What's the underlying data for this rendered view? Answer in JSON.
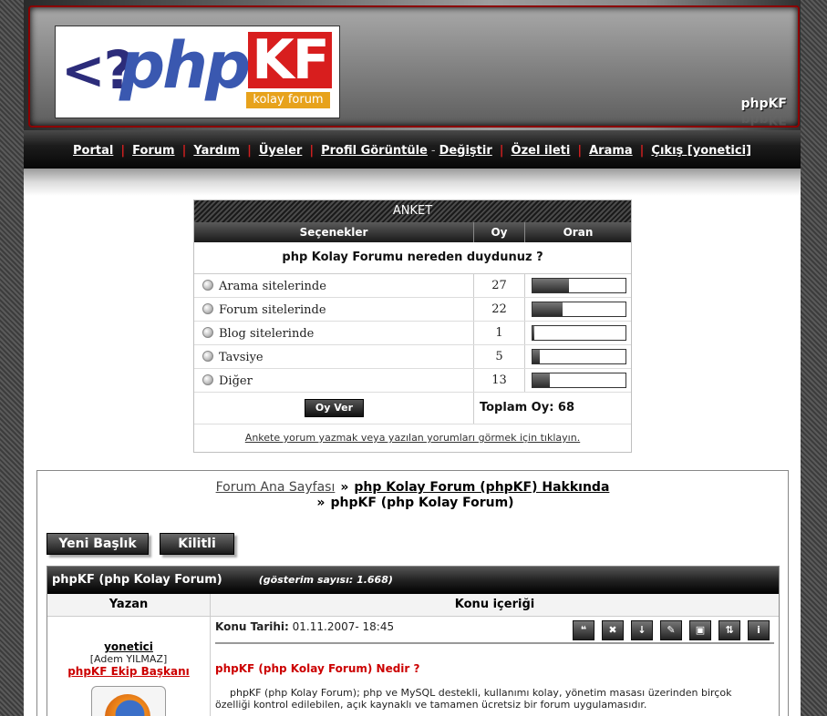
{
  "header": {
    "logo": {
      "prefix": "<?",
      "php": "php",
      "kf": "KF",
      "tagline": "kolay forum"
    },
    "brand": "phpKF"
  },
  "nav": {
    "portal": "Portal",
    "forum": "Forum",
    "help": "Yardım",
    "members": "Üyeler",
    "profile_view": "Profil Görüntüle",
    "profile_edit": "Değiştir",
    "pm": "Özel ileti",
    "search": "Arama",
    "logout": "Çıkış [yonetici]",
    "separator": "|",
    "dash": "-"
  },
  "poll": {
    "title": "ANKET",
    "col_options": "Seçenekler",
    "col_votes": "Oy",
    "col_ratio": "Oran",
    "question": "php Kolay Forumu nereden duydunuz ?",
    "options": [
      {
        "label": "Arama sitelerinde",
        "votes": "27",
        "ratio": 0.397
      },
      {
        "label": "Forum sitelerinde",
        "votes": "22",
        "ratio": 0.324
      },
      {
        "label": "Blog sitelerinde",
        "votes": "1",
        "ratio": 0.015
      },
      {
        "label": "Tavsiye",
        "votes": "5",
        "ratio": 0.074
      },
      {
        "label": "Diğer",
        "votes": "13",
        "ratio": 0.191
      }
    ],
    "vote_button": "Oy Ver",
    "total": "Toplam Oy: 68",
    "comment_link": "Ankete yorum yazmak veya yazılan yorumları görmek için tıklayın."
  },
  "breadcrumb": {
    "home": "Forum Ana Sayfası",
    "category": "php Kolay Forum (phpKF) Hakkında",
    "arrow": "»",
    "current": "phpKF (php Kolay Forum)"
  },
  "buttons": {
    "new_topic": "Yeni Başlık",
    "locked": "Kilitli"
  },
  "topic": {
    "title": "phpKF (php Kolay Forum)",
    "views": "(gösterim sayısı: 1.668)",
    "col_author": "Yazan",
    "col_content": "Konu içeriği",
    "author": {
      "username": "yonetici",
      "realname": "[Adem YILMAZ]",
      "role": "phpKF Ekip Başkanı",
      "avatar_icon": "firefox-avatar"
    },
    "date_label": "Konu Tarihi:",
    "date": "01.11.2007- 18:45",
    "post_title": "phpKF (php Kolay Forum) Nedir ?",
    "post_text": "phpKF (php Kolay Forum); php ve MySQL destekli, kullanımı kolay, yönetim masası üzerinden birçok özelliği kontrol edilebilen, açık kaynaklı ve tamamen ücretsiz bir forum uygulamasıdır.",
    "icons": [
      "quote-icon",
      "delete-icon",
      "move-icon",
      "edit-icon",
      "lock-icon",
      "split-icon",
      "info-icon"
    ]
  }
}
